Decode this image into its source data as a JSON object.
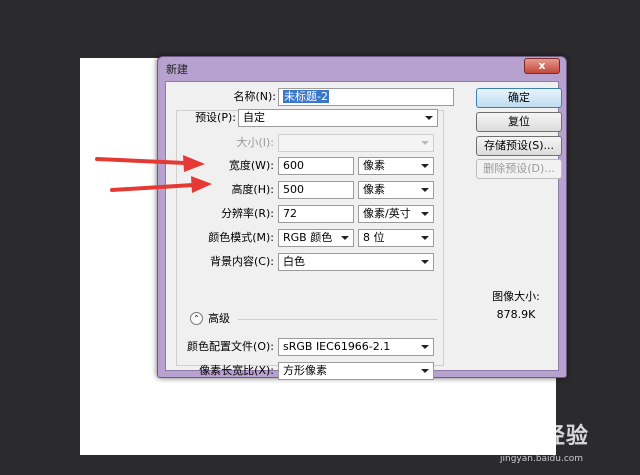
{
  "dialog": {
    "title": "新建",
    "close_label": "x",
    "name_label": "名称(N):",
    "name_value": "未标题-2",
    "preset_label": "预设(P):",
    "preset_value": "自定",
    "size_label": "大小(I):",
    "size_value": "",
    "width_label": "宽度(W):",
    "width_value": "600",
    "width_unit": "像素",
    "height_label": "高度(H):",
    "height_value": "500",
    "height_unit": "像素",
    "resolution_label": "分辨率(R):",
    "resolution_value": "72",
    "resolution_unit": "像素/英寸",
    "color_mode_label": "颜色模式(M):",
    "color_mode_value": "RGB 颜色",
    "bit_depth_value": "8 位",
    "background_label": "背景内容(C):",
    "background_value": "白色",
    "advanced_label": "高级",
    "color_profile_label": "颜色配置文件(O):",
    "color_profile_value": "sRGB IEC61966-2.1",
    "pixel_aspect_label": "像素长宽比(X):",
    "pixel_aspect_value": "方形像素",
    "buttons": {
      "ok": "确定",
      "reset": "复位",
      "save_preset": "存储预设(S)...",
      "delete_preset": "删除预设(D)..."
    },
    "image_size_label": "图像大小:",
    "image_size_value": "878.9K"
  },
  "watermark": {
    "brand": "Bai 经验",
    "url": "jingyan.baidu.com"
  },
  "colors": {
    "title_bar": "#b7a1cf",
    "arrow": "#e53935",
    "primary_button": "#bfdcf2",
    "selection": "#3a77c8"
  }
}
